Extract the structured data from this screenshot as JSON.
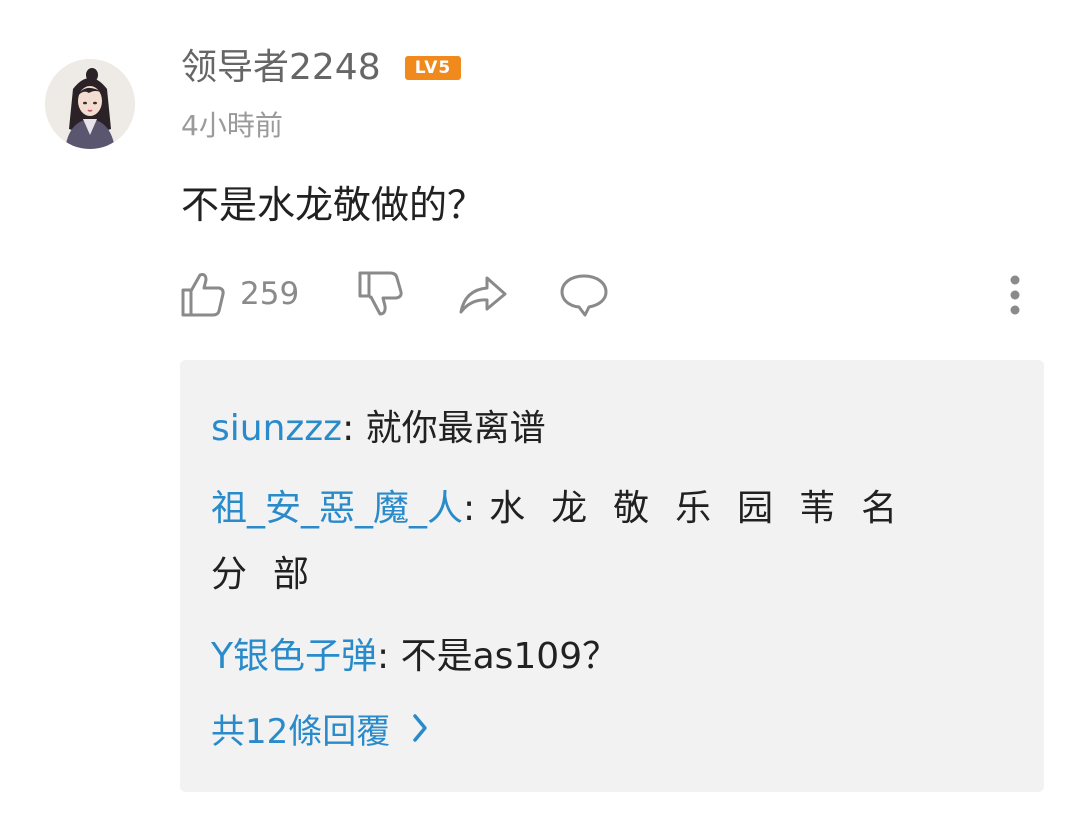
{
  "comment": {
    "username": "领导者2248",
    "level_badge": "LV5",
    "timestamp": "4小時前",
    "text": "不是水龙敬做的？",
    "like_count": "259",
    "icons": {
      "like": "thumbs-up-icon",
      "dislike": "thumbs-down-icon",
      "share": "share-icon",
      "reply": "comment-bubble-icon",
      "more": "more-vertical-icon"
    }
  },
  "replies": [
    {
      "author": "siunzzz",
      "separator": ": ",
      "text": "就你最离谱"
    },
    {
      "author": "祖_安_惡_魔_人",
      "separator": ":",
      "text": "水龙敬乐园苇名",
      "text_cont": "分部"
    },
    {
      "author": "Y银色子弹",
      "separator": ": ",
      "text": "不是as109？"
    }
  ],
  "more_replies_label": "共12條回覆",
  "colors": {
    "link_blue": "#2a8bcb",
    "badge_orange": "#f08a1c",
    "reply_bg": "#f2f2f2",
    "icon_gray": "#8a8a8a"
  }
}
